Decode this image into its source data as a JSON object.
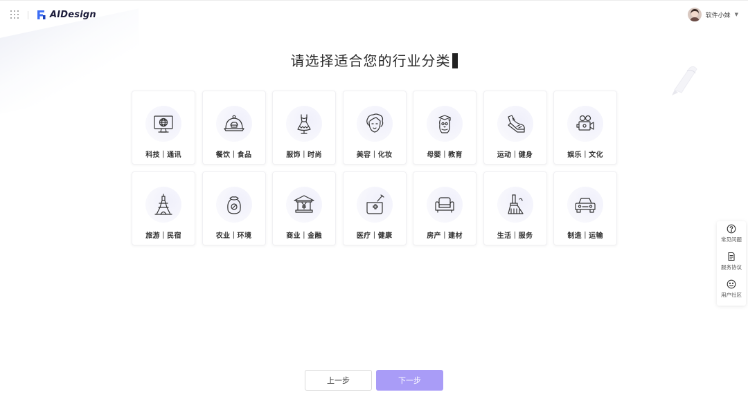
{
  "header": {
    "logo_text": "AIDesign",
    "user_name": "软件小妹"
  },
  "main": {
    "title": "请选择适合您的行业分类"
  },
  "industries": [
    {
      "label": "科技｜通讯",
      "icon": "monitor-globe-icon"
    },
    {
      "label": "餐饮｜食品",
      "icon": "food-cloche-icon"
    },
    {
      "label": "服饰｜时尚",
      "icon": "dress-hanger-icon"
    },
    {
      "label": "美容｜化妆",
      "icon": "woman-face-icon"
    },
    {
      "label": "母婴｜教育",
      "icon": "baby-graduate-icon"
    },
    {
      "label": "运动｜健身",
      "icon": "sneaker-icon"
    },
    {
      "label": "娱乐｜文化",
      "icon": "film-camera-icon"
    },
    {
      "label": "旅游｜民宿",
      "icon": "eiffel-tower-icon"
    },
    {
      "label": "农业｜环境",
      "icon": "grain-sack-icon"
    },
    {
      "label": "商业｜金融",
      "icon": "bank-yen-icon"
    },
    {
      "label": "医疗｜健康",
      "icon": "medicine-mortar-icon"
    },
    {
      "label": "房产｜建材",
      "icon": "armchair-icon"
    },
    {
      "label": "生活｜服务",
      "icon": "broom-icon"
    },
    {
      "label": "制造｜运输",
      "icon": "car-icon"
    }
  ],
  "help_panel": {
    "items": [
      {
        "label": "常见问题",
        "icon": "question-circle-icon"
      },
      {
        "label": "服务协议",
        "icon": "document-icon"
      },
      {
        "label": "用户社区",
        "icon": "smile-face-icon"
      }
    ]
  },
  "footer": {
    "prev_label": "上一步",
    "next_label": "下一步"
  },
  "colors": {
    "accent": "#a99cf7",
    "logo_blue": "#3d6ef5"
  }
}
